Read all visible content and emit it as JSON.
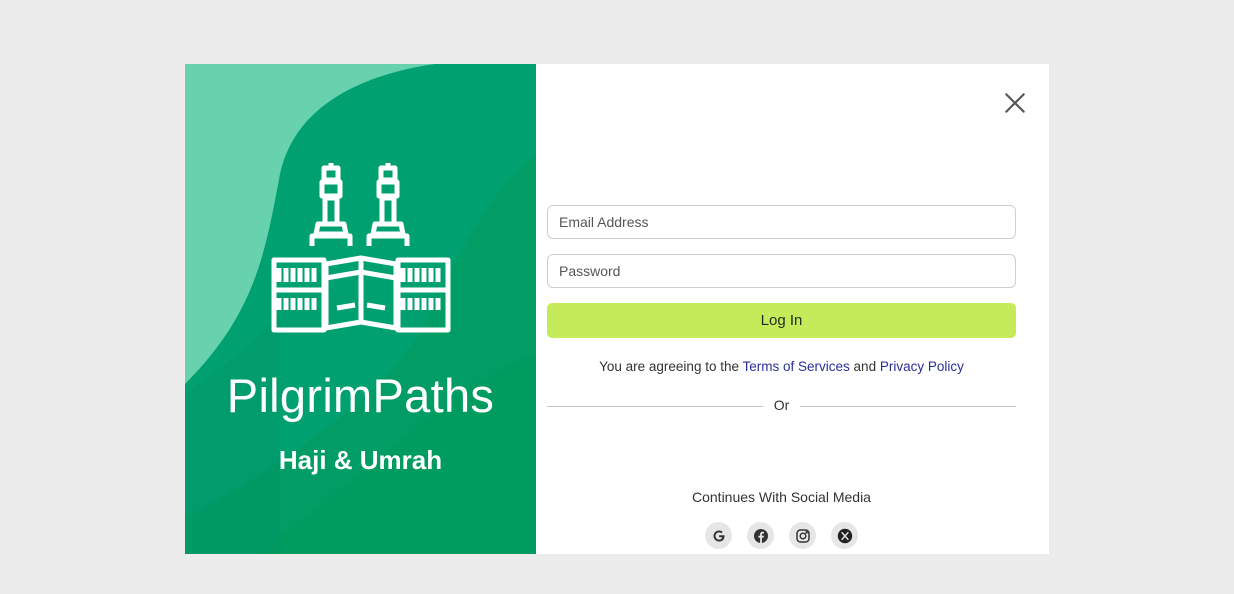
{
  "brand": {
    "name": "PilgrimPaths",
    "tagline": "Haji & Umrah"
  },
  "form": {
    "email_placeholder": "Email Address",
    "password_placeholder": "Password",
    "login_label": "Log In",
    "agree_prefix": "You are agreeing to the",
    "terms_link": "Terms of Services",
    "and_word": "and",
    "privacy_link": "Privacy Policy",
    "divider_label": "Or",
    "social_caption": "Continues With Social Media"
  },
  "social": [
    {
      "icon": "google-icon"
    },
    {
      "icon": "facebook-icon"
    },
    {
      "icon": "instagram-icon"
    },
    {
      "icon": "x-icon"
    }
  ],
  "colors": {
    "brand_green": "#00a070",
    "brand_light_green": "#68d1ae",
    "login_button": "#c5ea5a",
    "link_color": "#2a2f9a",
    "page_background": "#ececec"
  }
}
